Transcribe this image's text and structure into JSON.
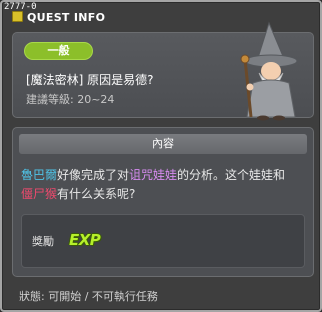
{
  "window": {
    "quest_id": "2777-0",
    "title": "QUEST INFO"
  },
  "info": {
    "category": "一般",
    "quest_name": "[魔法密林] 原因是易德?",
    "recommended_level": "建議等級: 20~24",
    "npc_portrait": "wizard-npc-portrait"
  },
  "content": {
    "header": "內容",
    "text_parts": {
      "npc": "魯巴爾",
      "part1": "好像完成了对",
      "item": "诅咒娃娃",
      "part2": "的分析。这个娃娃和",
      "mob": "僵尸猴",
      "part3": "有什么关系呢?"
    },
    "reward_label": "獎勵",
    "reward_icon": "EXP"
  },
  "status": "狀態: 可開始 / 不可執行任務",
  "colors": {
    "category_badge": "#8cbf2a",
    "npc_name": "#4fc4e8",
    "item_name": "#d68cf0",
    "mob_name": "#f04a6e",
    "exp": "#b6f02a"
  }
}
